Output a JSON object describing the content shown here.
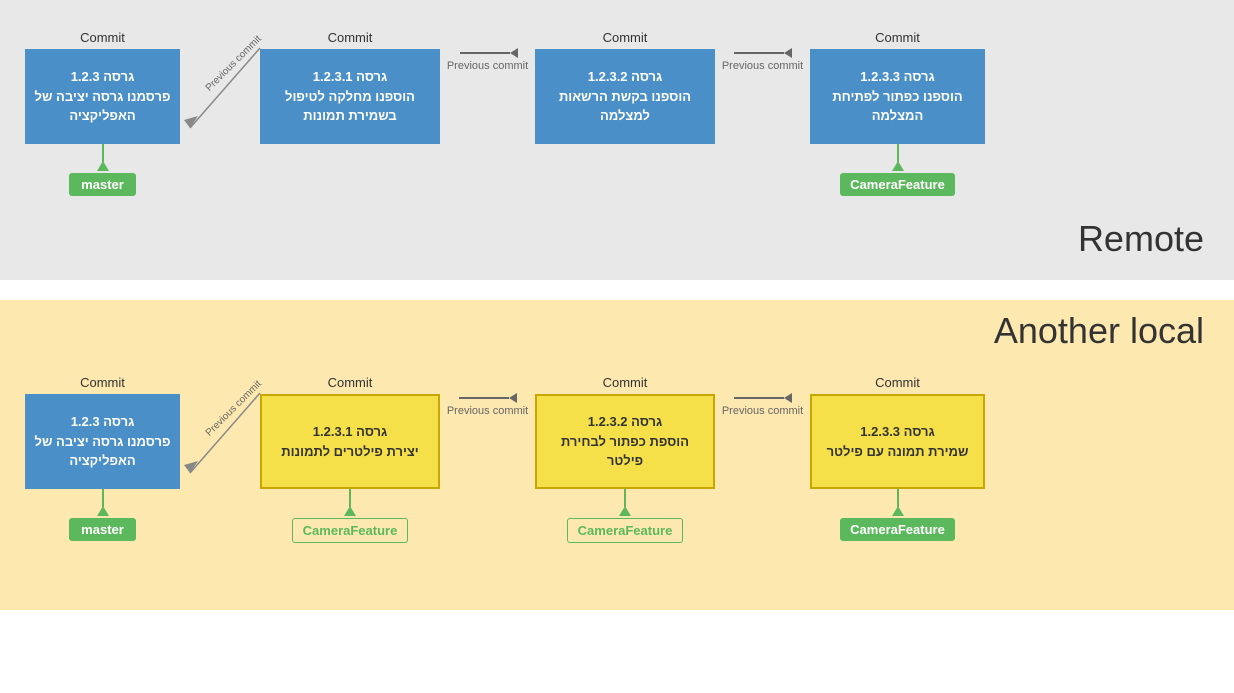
{
  "remote": {
    "label": "Remote",
    "commits": [
      {
        "label": "Commit",
        "version": "גרסה 1.2.3",
        "text": "פרסמנו גרסה יציבה של האפליקציה",
        "branch": "master",
        "style": "blue"
      },
      {
        "label": "Commit",
        "version": "גרסה 1.2.3.1",
        "text": "הוספנו מחלקה לטיפול בשמירת תמונות",
        "branch": null,
        "style": "blue"
      },
      {
        "label": "Commit",
        "version": "גרסה 1.2.3.2",
        "text": "הוספנו בקשת הרשאות למצלמה",
        "branch": null,
        "style": "blue"
      },
      {
        "label": "Commit",
        "version": "גרסה 1.2.3.3",
        "text": "הוספנו כפתור לפתיחת המצלמה",
        "branch": "CameraFeature",
        "style": "blue"
      }
    ],
    "prev_commit_label": "Previous commit"
  },
  "local": {
    "label": "Another local",
    "commits": [
      {
        "label": "Commit",
        "version": "גרסה 1.2.3",
        "text": "פרסמנו גרסה יציבה של האפליקציה",
        "branch": "master",
        "style": "blue"
      },
      {
        "label": "Commit",
        "version": "גרסה 1.2.3.1",
        "text": "יצירת פילטרים לתמונות",
        "branch": "CameraFeature",
        "branch_ghost": true,
        "style": "yellow"
      },
      {
        "label": "Commit",
        "version": "גרסה 1.2.3.2",
        "text": "הוספת כפתור לבחירת פילטר",
        "branch": "CameraFeature",
        "branch_ghost": true,
        "style": "yellow"
      },
      {
        "label": "Commit",
        "version": "גרסה 1.2.3.3",
        "text": "שמירת תמונה עם פילטר",
        "branch": "CameraFeature",
        "branch_ghost": false,
        "style": "yellow"
      }
    ],
    "prev_commit_label": "Previous commit"
  }
}
